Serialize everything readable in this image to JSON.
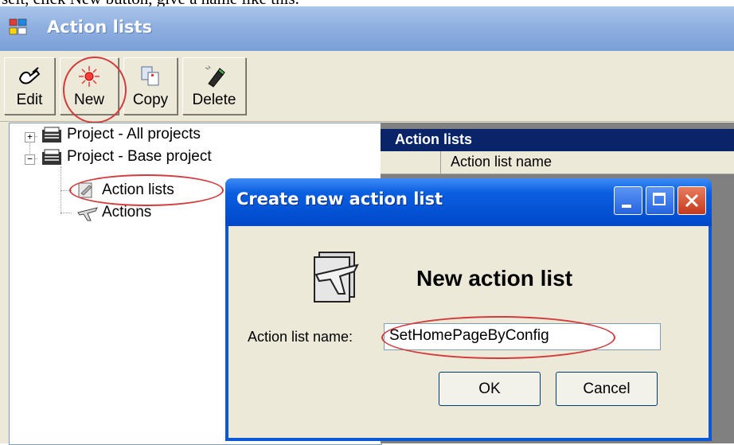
{
  "caption": "selt, click New button, give a name like this.",
  "window": {
    "title": "Action lists"
  },
  "toolbar": {
    "edit_label": "Edit",
    "new_label": "New",
    "copy_label": "Copy",
    "delete_label": "Delete"
  },
  "tree": {
    "items": [
      {
        "label": "Project - All projects",
        "expander": "+"
      },
      {
        "label": "Project - Base project",
        "expander": "−"
      },
      {
        "label": "Action lists"
      },
      {
        "label": "Actions"
      }
    ]
  },
  "list_pane": {
    "header": "Action lists",
    "column": "Action list name"
  },
  "dialog": {
    "title": "Create new action list",
    "heading": "New action list",
    "name_label": "Action list name:",
    "name_value": "SetHomePageByConfig",
    "ok_label": "OK",
    "cancel_label": "Cancel"
  },
  "colors": {
    "highlight_circle": "#d33b3b",
    "title_blue": "#0452d4",
    "selection_navy": "#0a246a"
  }
}
